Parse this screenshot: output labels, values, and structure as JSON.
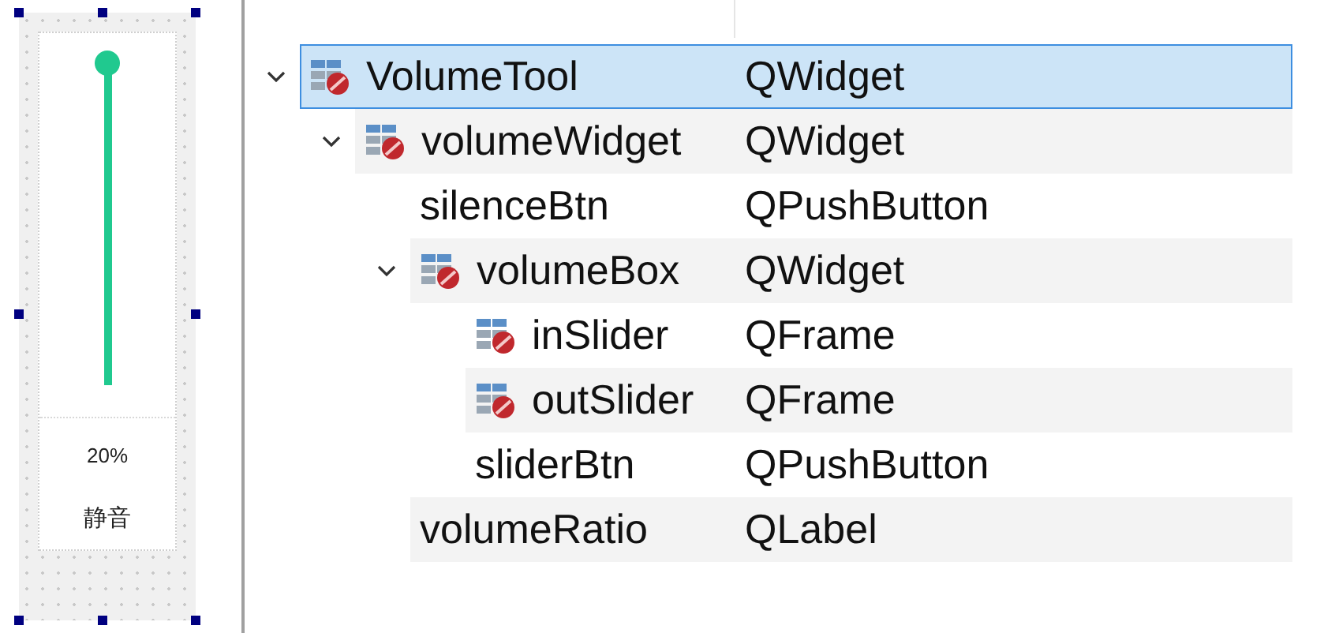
{
  "designer_preview": {
    "slider": {
      "level": 1
    },
    "ratio_label": "20%",
    "mute_button": "静音"
  },
  "object_tree": {
    "items": [
      {
        "name": "VolumeTool",
        "class": "QWidget",
        "icon": true,
        "expanded": true,
        "selected": true,
        "children": [
          {
            "name": "volumeWidget",
            "class": "QWidget",
            "icon": true,
            "expanded": true,
            "selected": false,
            "children": [
              {
                "name": "silenceBtn",
                "class": "QPushButton",
                "icon": false,
                "selected": false
              },
              {
                "name": "volumeBox",
                "class": "QWidget",
                "icon": true,
                "expanded": true,
                "selected": false,
                "children": [
                  {
                    "name": "inSlider",
                    "class": "QFrame",
                    "icon": true,
                    "selected": false
                  },
                  {
                    "name": "outSlider",
                    "class": "QFrame",
                    "icon": true,
                    "selected": false
                  },
                  {
                    "name": "sliderBtn",
                    "class": "QPushButton",
                    "icon": false,
                    "selected": false
                  }
                ]
              },
              {
                "name": "volumeRatio",
                "class": "QLabel",
                "icon": false,
                "selected": false
              }
            ]
          }
        ]
      }
    ]
  }
}
